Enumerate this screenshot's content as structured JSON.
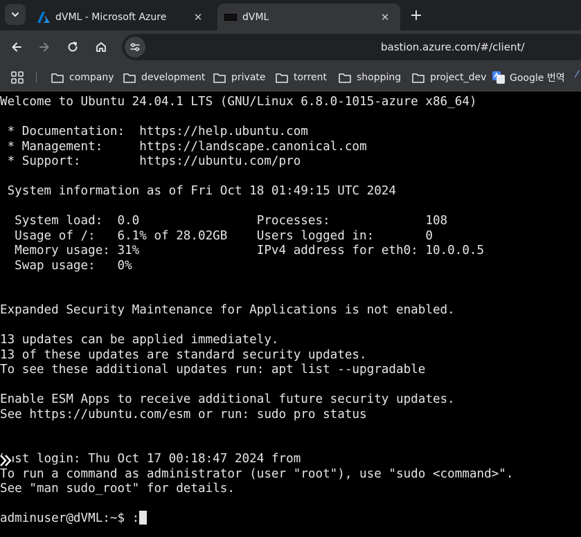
{
  "browser": {
    "tabs": [
      {
        "title": "dVML - Microsoft Azure",
        "icon": "azure-logo-icon",
        "active": false
      },
      {
        "title": "dVML",
        "icon": "terminal-icon",
        "active": true
      }
    ],
    "url": "bastion.azure.com/#/client/",
    "bookmarks": [
      {
        "label": "company",
        "icon": "folder-icon"
      },
      {
        "label": "development",
        "icon": "folder-icon"
      },
      {
        "label": "private",
        "icon": "folder-icon"
      },
      {
        "label": "torrent",
        "icon": "folder-icon"
      },
      {
        "label": "shopping",
        "icon": "folder-icon"
      },
      {
        "label": "project_dev",
        "icon": "folder-icon"
      },
      {
        "label": "Google 번역",
        "icon": "google-translate-icon"
      }
    ],
    "colors": {
      "tabbar": "#202124",
      "toolbar": "#35363a",
      "text": "#e8eaed",
      "azure_blue": "#0078d4"
    }
  },
  "terminal": {
    "lines": [
      "Welcome to Ubuntu 24.04.1 LTS (GNU/Linux 6.8.0-1015-azure x86_64)",
      "",
      " * Documentation:  https://help.ubuntu.com",
      " * Management:     https://landscape.canonical.com",
      " * Support:        https://ubuntu.com/pro",
      "",
      " System information as of Fri Oct 18 01:49:15 UTC 2024",
      "",
      "  System load:  0.0                Processes:             108",
      "  Usage of /:   6.1% of 28.02GB    Users logged in:       0",
      "  Memory usage: 31%                IPv4 address for eth0: 10.0.0.5",
      "  Swap usage:   0%",
      "",
      "",
      "Expanded Security Maintenance for Applications is not enabled.",
      "",
      "13 updates can be applied immediately.",
      "13 of these updates are standard security updates.",
      "To see these additional updates run: apt list --upgradable",
      "",
      "Enable ESM Apps to receive additional future security updates.",
      "See https://ubuntu.com/esm or run: sudo pro status",
      "",
      "",
      "Last login: Thu Oct 17 00:18:47 2024 from",
      "To run a command as administrator (user \"root\"), use \"sudo <command>\".",
      "See \"man sudo_root\" for details.",
      ""
    ],
    "prompt": "adminuser@dVML:~$ :",
    "colors": {
      "background": "#000000",
      "foreground": "#e6e6e6"
    }
  }
}
